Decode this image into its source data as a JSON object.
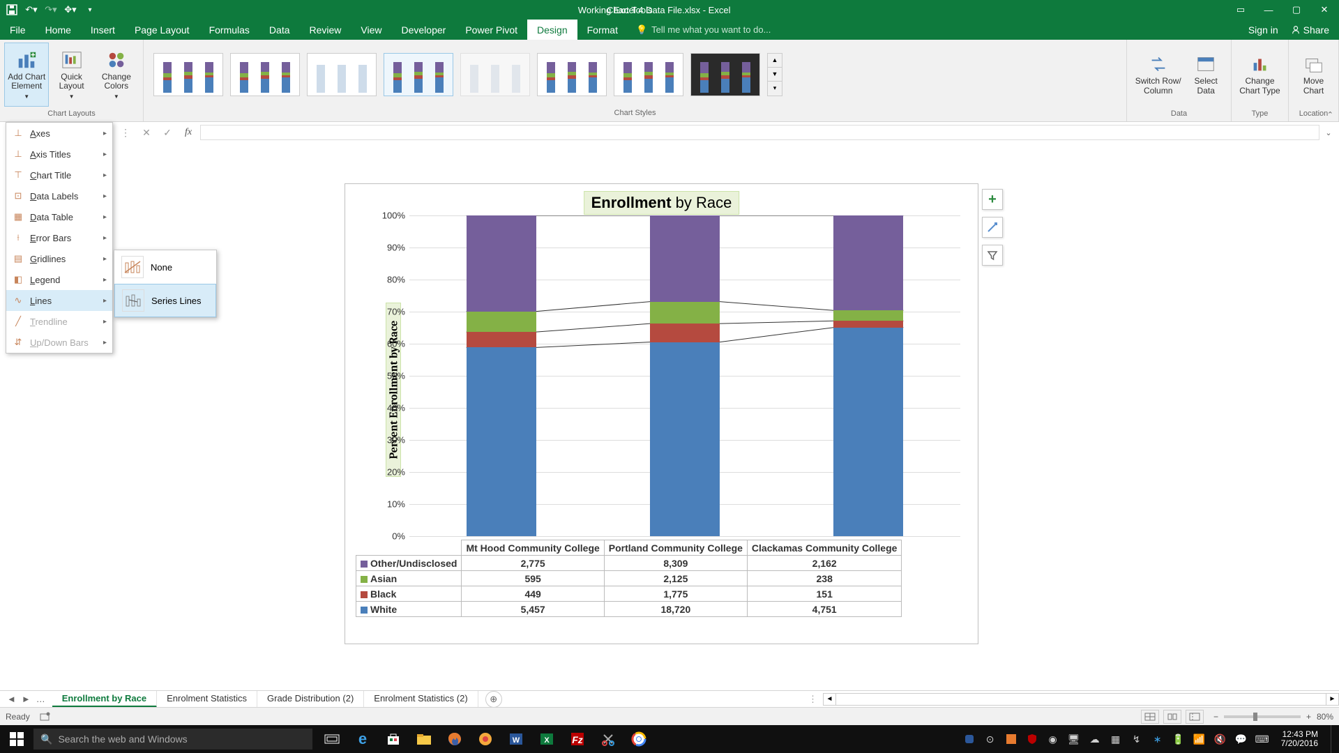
{
  "titlebar": {
    "filename": "Working Excel 4 Data File.xlsx - Excel",
    "chart_tools": "Chart Tools"
  },
  "ribbon": {
    "tabs": [
      "File",
      "Home",
      "Insert",
      "Page Layout",
      "Formulas",
      "Data",
      "Review",
      "View",
      "Developer",
      "Power Pivot",
      "Design",
      "Format"
    ],
    "active_tab": "Design",
    "tell_me": "Tell me what you want to do...",
    "sign_in": "Sign in",
    "share": "Share",
    "groups": {
      "layouts_label": "Chart Layouts",
      "styles_label": "Chart Styles",
      "data_label": "Data",
      "type_label": "Type",
      "location_label": "Location"
    },
    "buttons": {
      "add_chart_element": "Add Chart\nElement",
      "quick_layout": "Quick\nLayout",
      "change_colors": "Change\nColors",
      "switch_row_col": "Switch Row/\nColumn",
      "select_data": "Select\nData",
      "change_chart_type": "Change\nChart Type",
      "move_chart": "Move\nChart"
    }
  },
  "add_element_menu": {
    "items": [
      {
        "label": "Axes",
        "key": "axes"
      },
      {
        "label": "Axis Titles",
        "key": "axis-titles"
      },
      {
        "label": "Chart Title",
        "key": "chart-title"
      },
      {
        "label": "Data Labels",
        "key": "data-labels"
      },
      {
        "label": "Data Table",
        "key": "data-table"
      },
      {
        "label": "Error Bars",
        "key": "error-bars"
      },
      {
        "label": "Gridlines",
        "key": "gridlines"
      },
      {
        "label": "Legend",
        "key": "legend"
      },
      {
        "label": "Lines",
        "key": "lines"
      },
      {
        "label": "Trendline",
        "key": "trendline",
        "disabled": true
      },
      {
        "label": "Up/Down Bars",
        "key": "updown",
        "disabled": true
      }
    ],
    "submenu": {
      "none": "None",
      "series_lines": "Series Lines"
    }
  },
  "formula_bar": {
    "value": ""
  },
  "chart": {
    "title_bold": "Enrollment",
    "title_rest": " by Race",
    "y_axis_label": "Percent Enrollment by Race",
    "y_ticks": [
      "0%",
      "10%",
      "20%",
      "30%",
      "40%",
      "50%",
      "60%",
      "70%",
      "80%",
      "90%",
      "100%"
    ]
  },
  "chart_data": {
    "type": "bar",
    "stacked": true,
    "normalized": true,
    "categories": [
      "Mt Hood Community College",
      "Portland Community College",
      "Clackamas Community College"
    ],
    "series": [
      {
        "name": "White",
        "values": [
          5457,
          18720,
          4751
        ],
        "color": "#4a7fba"
      },
      {
        "name": "Black",
        "values": [
          449,
          1775,
          151
        ],
        "color": "#b54a3f"
      },
      {
        "name": "Asian",
        "values": [
          595,
          2125,
          238
        ],
        "color": "#84b146"
      },
      {
        "name": "Other/Undisclosed",
        "values": [
          2775,
          8309,
          2162
        ],
        "color": "#755f9b"
      }
    ],
    "ylabel": "Percent Enrollment by Race",
    "ylim": [
      0,
      100
    ],
    "data_table_rows": [
      {
        "label": "Other/Undisclosed",
        "color": "#755f9b",
        "values": [
          "2,775",
          "8,309",
          "2,162"
        ]
      },
      {
        "label": "Asian",
        "color": "#84b146",
        "values": [
          "595",
          "2,125",
          "238"
        ]
      },
      {
        "label": "Black",
        "color": "#b54a3f",
        "values": [
          "449",
          "1,775",
          "151"
        ]
      },
      {
        "label": "White",
        "color": "#4a7fba",
        "values": [
          "5,457",
          "18,720",
          "4,751"
        ]
      }
    ]
  },
  "sheet_tabs": {
    "tabs": [
      "Enrollment by Race",
      "Enrolment Statistics",
      "Grade Distribution (2)",
      "Enrolment Statistics (2)"
    ],
    "active": "Enrollment by Race"
  },
  "statusbar": {
    "ready": "Ready",
    "zoom": "80%"
  },
  "taskbar": {
    "search_placeholder": "Search the web and Windows",
    "clock": {
      "time": "12:43 PM",
      "date": "7/20/2016"
    }
  }
}
